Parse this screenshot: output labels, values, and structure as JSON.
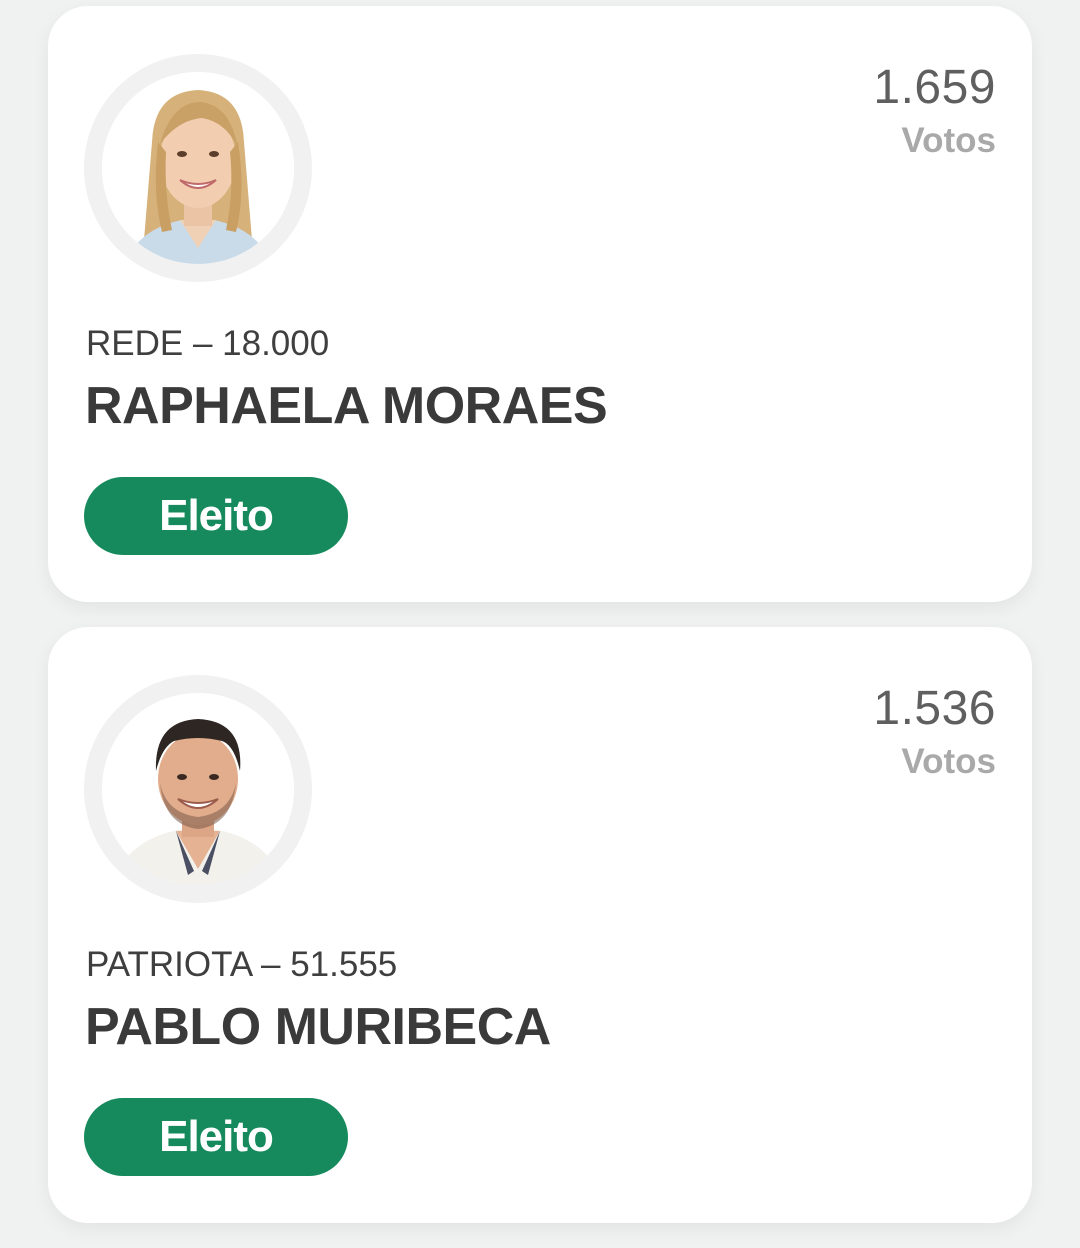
{
  "candidates": [
    {
      "votes": "1.659",
      "votes_label": "Votos",
      "party_number": "REDE – 18.000",
      "name": "RAPHAELA MORAES",
      "status": "Eleito",
      "photo": "candidate-photo-woman-blonde"
    },
    {
      "votes": "1.536",
      "votes_label": "Votos",
      "party_number": "PATRIOTA – 51.555",
      "name": "PABLO MURIBECA",
      "status": "Eleito",
      "photo": "candidate-photo-man-dark-hair"
    }
  ],
  "colors": {
    "background": "#f0f1f1",
    "card": "#ffffff",
    "elected_badge": "#168a5d",
    "votes_count": "#5f5f5f",
    "votes_label": "#a9a9a9",
    "name": "#3a3a3a"
  }
}
